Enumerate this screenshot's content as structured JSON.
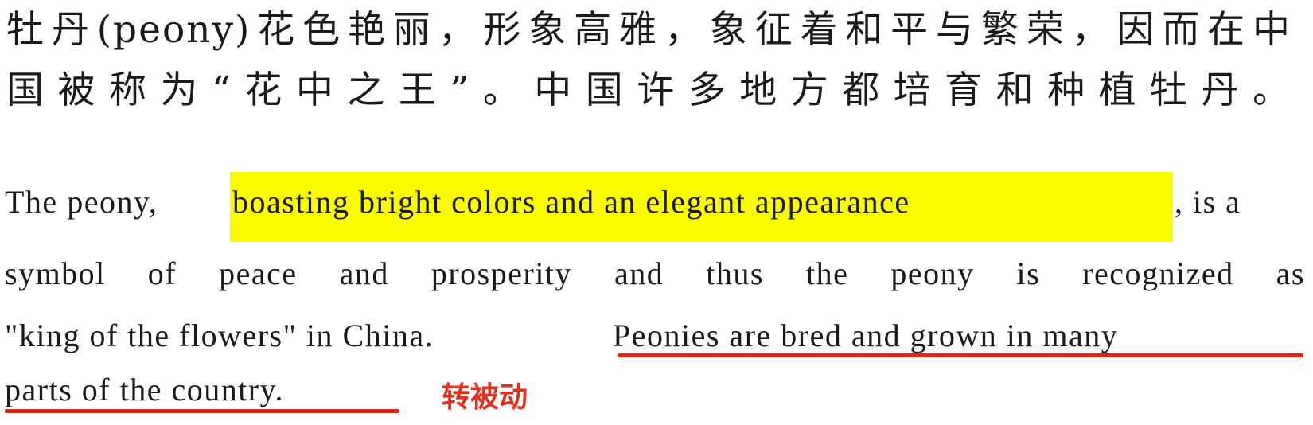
{
  "chinese": {
    "line1": "牡丹(peony)花色艳丽，形象高雅，象征着和平与繁荣，因而在中",
    "line2": "国被称为“花中之王”。中国许多地方都培育和种植牡丹。"
  },
  "english": {
    "line1_pre": "The peony,",
    "line1_highlight": "boasting bright colors and an elegant appearance",
    "line1_post": ", is a",
    "line2": "symbol of peace and prosperity and thus the peony is recognized as",
    "line3_pre": "\"king of the flowers\" in China.",
    "line3_underlined": "Peonies are bred and grown in many",
    "line4_underlined": "parts of the country."
  },
  "annotation": {
    "label": "转被动"
  },
  "colors": {
    "highlight": "#fbfb02",
    "underline": "#d42a1c",
    "annotation": "#e0301e"
  }
}
